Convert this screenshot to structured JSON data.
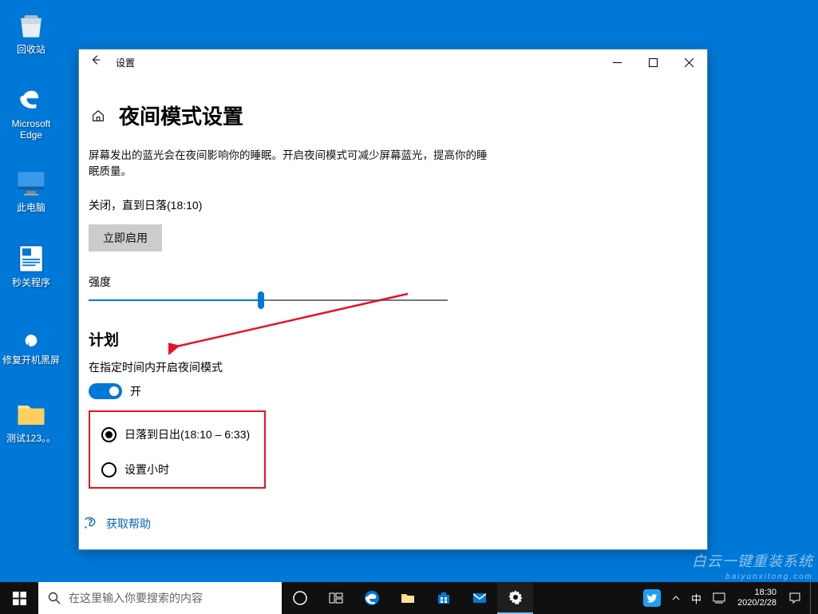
{
  "desktop_icons": [
    {
      "label": "回收站"
    },
    {
      "label": "Microsoft Edge"
    },
    {
      "label": "此电脑"
    },
    {
      "label": "秒关程序"
    },
    {
      "label": "修复开机黑屏"
    },
    {
      "label": "测试123。。"
    }
  ],
  "window": {
    "app_title": "设置",
    "page_title": "夜间模式设置",
    "description": "屏幕发出的蓝光会在夜间影响你的睡眠。开启夜间模式可减少屏幕蓝光，提高你的睡眠质量。",
    "status": "关闭，直到日落(18:10)",
    "start_button": "立即启用",
    "strength_label": "强度",
    "slider_pct": 48,
    "schedule_heading": "计划",
    "schedule_switch_label": "在指定时间内开启夜间模式",
    "toggle_state": "开",
    "radio_option_sunset": "日落到日出(18:10 – 6:33)",
    "radio_option_hours": "设置小时",
    "help_text": "获取帮助"
  },
  "taskbar": {
    "search_placeholder": "在这里输入你要搜索的内容",
    "time": "18:30",
    "date": "2020/2/28"
  },
  "watermark": {
    "main": "白云一键重装系统",
    "sub": "baiyunxitong.com"
  }
}
